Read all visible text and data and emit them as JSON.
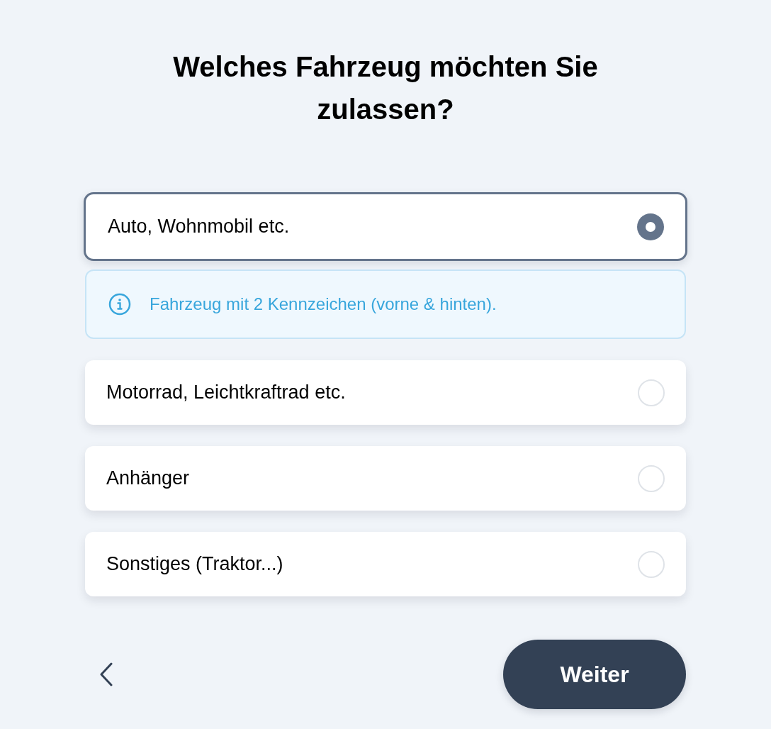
{
  "title": "Welches Fahrzeug möchten Sie zulassen?",
  "options": [
    {
      "label": "Auto, Wohnmobil etc.",
      "selected": true,
      "info": "Fahrzeug mit 2 Kennzeichen (vorne & hinten)."
    },
    {
      "label": "Motorrad, Leichtkraftrad etc.",
      "selected": false
    },
    {
      "label": "Anhänger",
      "selected": false
    },
    {
      "label": "Sonstiges (Traktor...)",
      "selected": false
    }
  ],
  "next_button": "Weiter"
}
